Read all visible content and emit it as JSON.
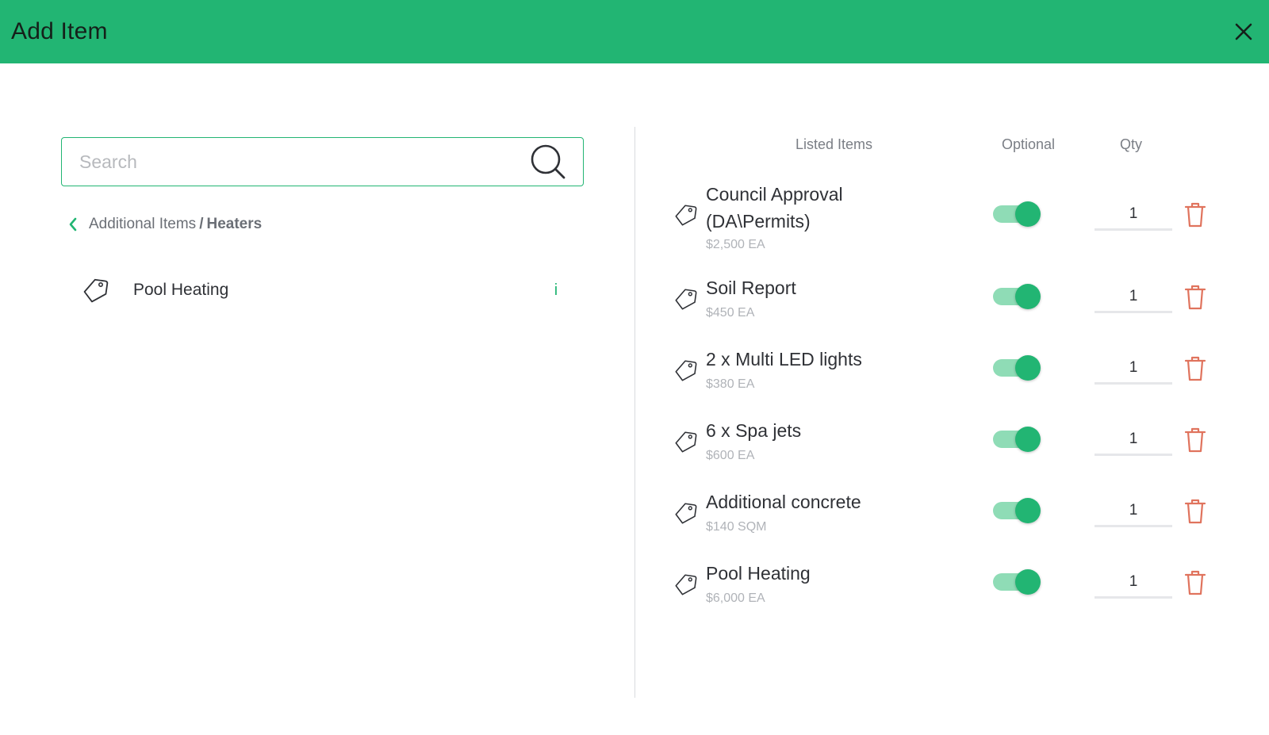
{
  "header": {
    "title": "Add Item",
    "close_icon": "close-icon"
  },
  "search": {
    "placeholder": "Search",
    "value": "",
    "icon": "search-icon"
  },
  "breadcrumb": {
    "parent": "Additional Items",
    "separator": "/",
    "current": "Heaters"
  },
  "catalog": [
    {
      "name": "Pool Heating",
      "info_label": "i"
    }
  ],
  "listed": {
    "columns": {
      "items": "Listed Items",
      "optional": "Optional",
      "qty": "Qty"
    },
    "items": [
      {
        "title_line1": "Council Approval",
        "title_line2": "(DA\\Permits)",
        "price": "$2,500 EA",
        "optional": true,
        "qty": "1"
      },
      {
        "title_line1": "Soil Report",
        "price": "$450 EA",
        "optional": true,
        "qty": "1"
      },
      {
        "title_line1": "2 x Multi LED lights",
        "price": "$380 EA",
        "optional": true,
        "qty": "1"
      },
      {
        "title_line1": "6 x Spa jets",
        "price": "$600 EA",
        "optional": true,
        "qty": "1"
      },
      {
        "title_line1": "Additional concrete",
        "price": "$140 SQM",
        "optional": true,
        "qty": "1"
      },
      {
        "title_line1": "Pool Heating",
        "price": "$6,000 EA",
        "optional": true,
        "qty": "1"
      }
    ]
  },
  "colors": {
    "accent": "#22b573",
    "toggle_track": "#8fdcb6",
    "trash": "#e0735d"
  }
}
